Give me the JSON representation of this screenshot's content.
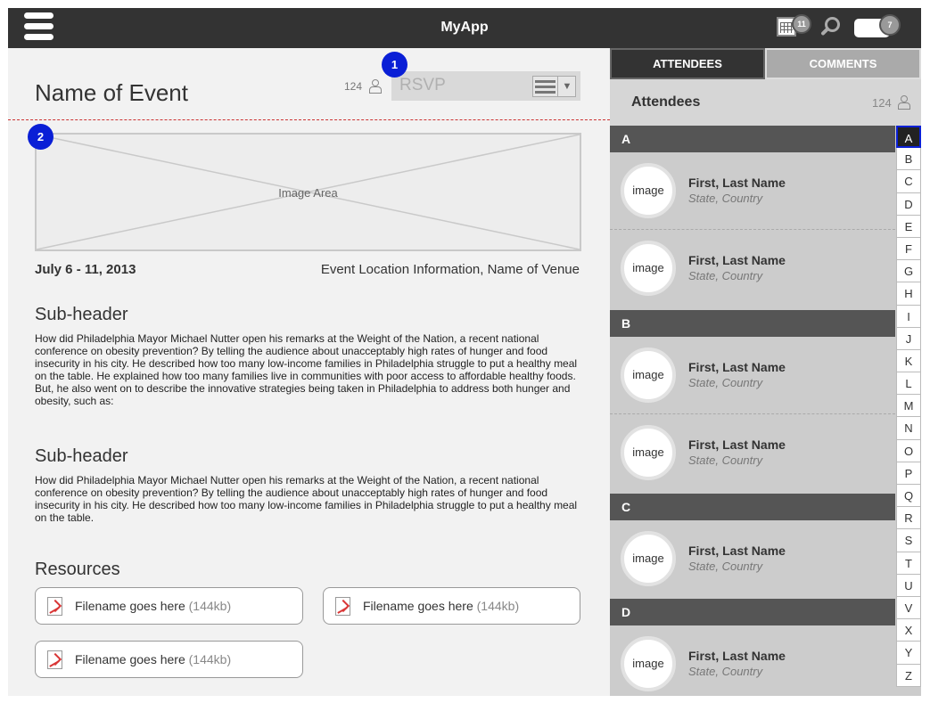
{
  "header": {
    "app_title": "MyApp",
    "calendar_badge": "11",
    "chat_badge": "7"
  },
  "event": {
    "title": "Name of Event",
    "attendee_count": "124",
    "rsvp_label": "RSVP",
    "image_label": "Image Area",
    "date": "July 6 - 11, 2013",
    "location": "Event  Location Information, Name of Venue"
  },
  "markers": [
    "1",
    "2"
  ],
  "sections": [
    {
      "header": "Sub-header",
      "body": "How did Philadelphia Mayor Michael Nutter open his remarks at the Weight of the Nation, a recent national conference on obesity prevention? By telling the audience about unacceptably high rates of hunger and food insecurity in his city. He described how too many low-income families in Philadelphia struggle to put a healthy meal on the table. He explained how too many families live in communities with poor access to affordable healthy foods. But, he also went on to describe the innovative strategies being taken in Philadelphia to address both hunger and obesity, such as:"
    },
    {
      "header": "Sub-header",
      "body": "How did Philadelphia Mayor Michael Nutter open his remarks at the Weight of the Nation, a recent national conference on obesity prevention? By telling the audience about unacceptably high rates of hunger and food insecurity in his city. He described how too many low-income families in Philadelphia struggle to put a healthy meal on the table."
    }
  ],
  "resources": {
    "header": "Resources",
    "files": [
      {
        "name": "Filename goes here",
        "size": "(144kb)"
      },
      {
        "name": "Filename goes here",
        "size": "(144kb)"
      },
      {
        "name": "Filename goes here",
        "size": "(144kb)"
      }
    ]
  },
  "panel": {
    "tabs": [
      "ATTENDEES",
      "COMMENTS"
    ],
    "title": "Attendees",
    "count": "124",
    "groups": [
      {
        "letter": "A",
        "people": [
          {
            "avatar": "image",
            "name": "First, Last Name",
            "location": "State, Country"
          },
          {
            "avatar": "image",
            "name": "First, Last Name",
            "location": "State, Country"
          }
        ]
      },
      {
        "letter": "B",
        "people": [
          {
            "avatar": "image",
            "name": "First, Last Name",
            "location": "State, Country"
          },
          {
            "avatar": "image",
            "name": "First, Last Name",
            "location": "State, Country"
          }
        ]
      },
      {
        "letter": "C",
        "people": [
          {
            "avatar": "image",
            "name": "First, Last Name",
            "location": "State, Country"
          }
        ]
      },
      {
        "letter": "D",
        "people": [
          {
            "avatar": "image",
            "name": "First, Last Name",
            "location": "State, Country"
          }
        ]
      }
    ],
    "alphabet": [
      "A",
      "B",
      "C",
      "D",
      "E",
      "F",
      "G",
      "H",
      "I",
      "J",
      "K",
      "L",
      "M",
      "N",
      "O",
      "P",
      "Q",
      "R",
      "S",
      "T",
      "U",
      "V",
      "X",
      "Y",
      "Z"
    ],
    "active_letter": "A"
  },
  "icons": {
    "menu": "hamburger-icon",
    "calendar": "calendar-icon",
    "search": "search-icon",
    "chat": "chat-icon",
    "person": "person-icon",
    "file": "pdf-icon"
  },
  "colors": {
    "topbar": "#333333",
    "marker": "#0a1fd6",
    "section_bar": "#555555",
    "divider": "#cc3333"
  }
}
